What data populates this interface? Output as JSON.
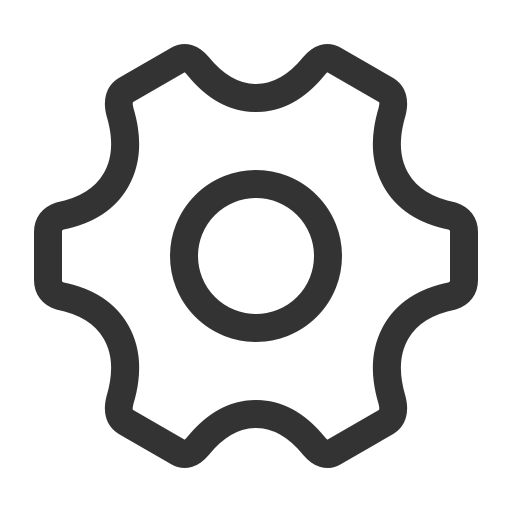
{
  "icon": {
    "name": "gear-icon",
    "outline_color": "#333333",
    "background_color": "#ffffff",
    "teeth_count": 6
  }
}
